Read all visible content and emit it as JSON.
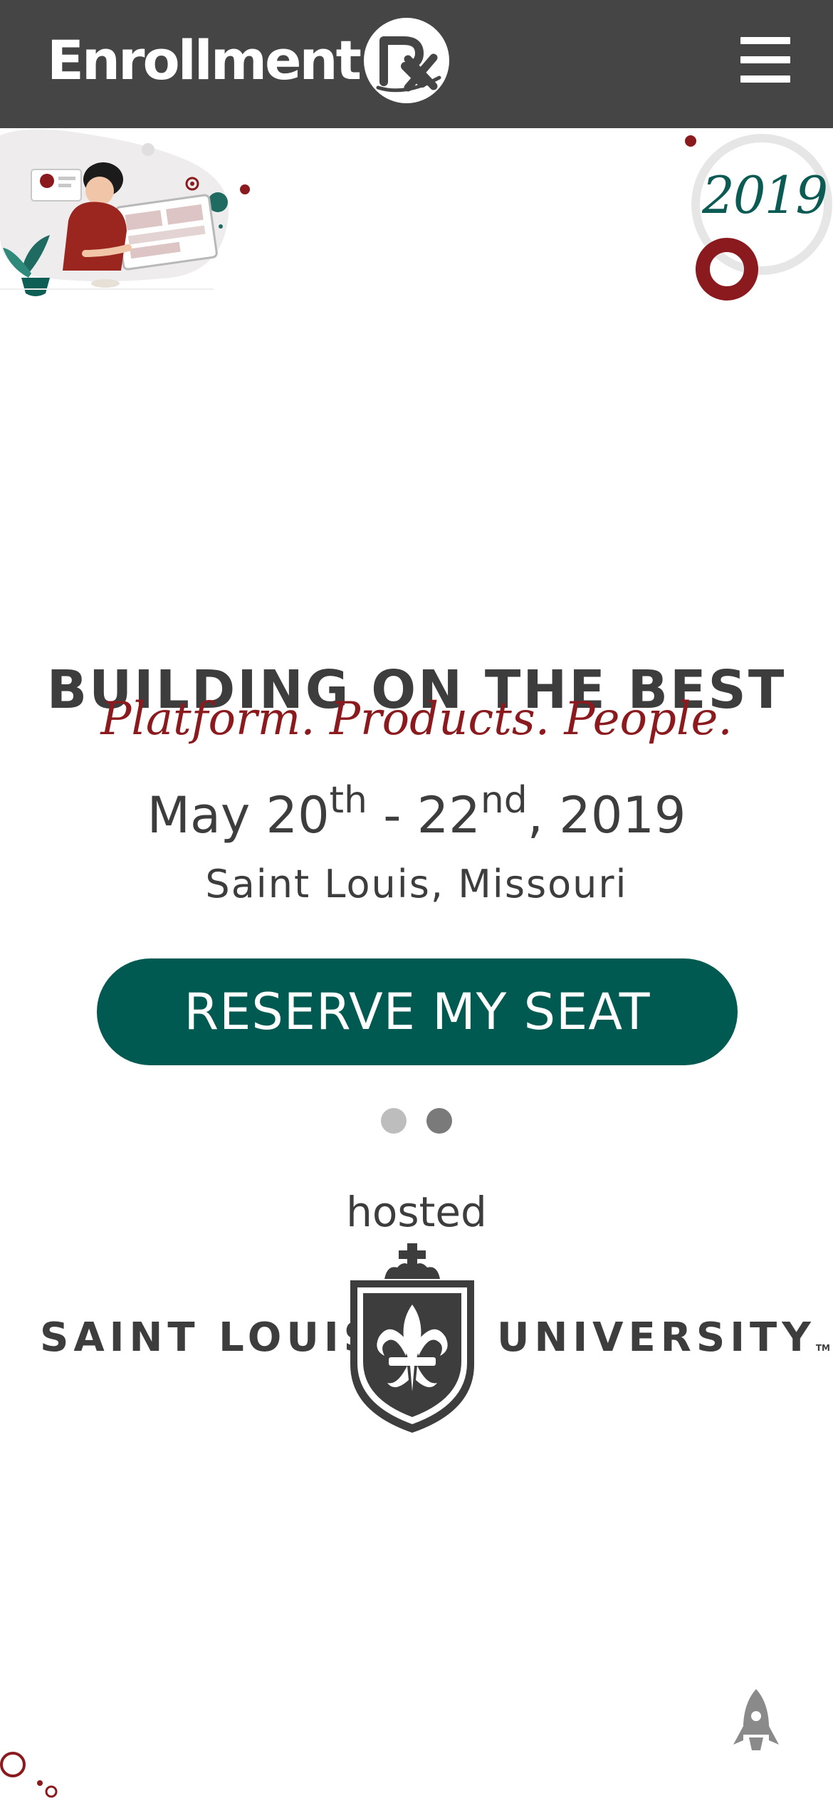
{
  "header": {
    "brand_word": "Enrollment",
    "brand_mark": "RX",
    "menu_icon": "hamburger-menu-icon"
  },
  "decor": {
    "illustration_icon": "person-at-computer-illustration",
    "year": "2019"
  },
  "hero": {
    "title": "BUILDING ON THE BEST",
    "tagline": "Platform. Products. People.",
    "date_start_day": "May 20",
    "date_start_suffix": "th",
    "date_separator": " - ",
    "date_end_day": "22",
    "date_end_suffix": "nd",
    "date_year": ", 2019",
    "location": "Saint Louis, Missouri",
    "cta_label": "RESERVE MY SEAT"
  },
  "carousel": {
    "slides": 2,
    "active_index": 2
  },
  "host": {
    "label": "hosted",
    "name_left": "SAINT LOUIS",
    "name_right": "UNIVERSITY",
    "trademark": "TM",
    "crest_icon": "fleur-de-lis-shield-icon"
  },
  "footer": {
    "scroll_top_icon": "rocket-icon"
  },
  "colors": {
    "header_bg": "#454545",
    "accent_teal": "#005a52",
    "accent_red": "#8b1a1e",
    "text": "#3d3d3d"
  }
}
